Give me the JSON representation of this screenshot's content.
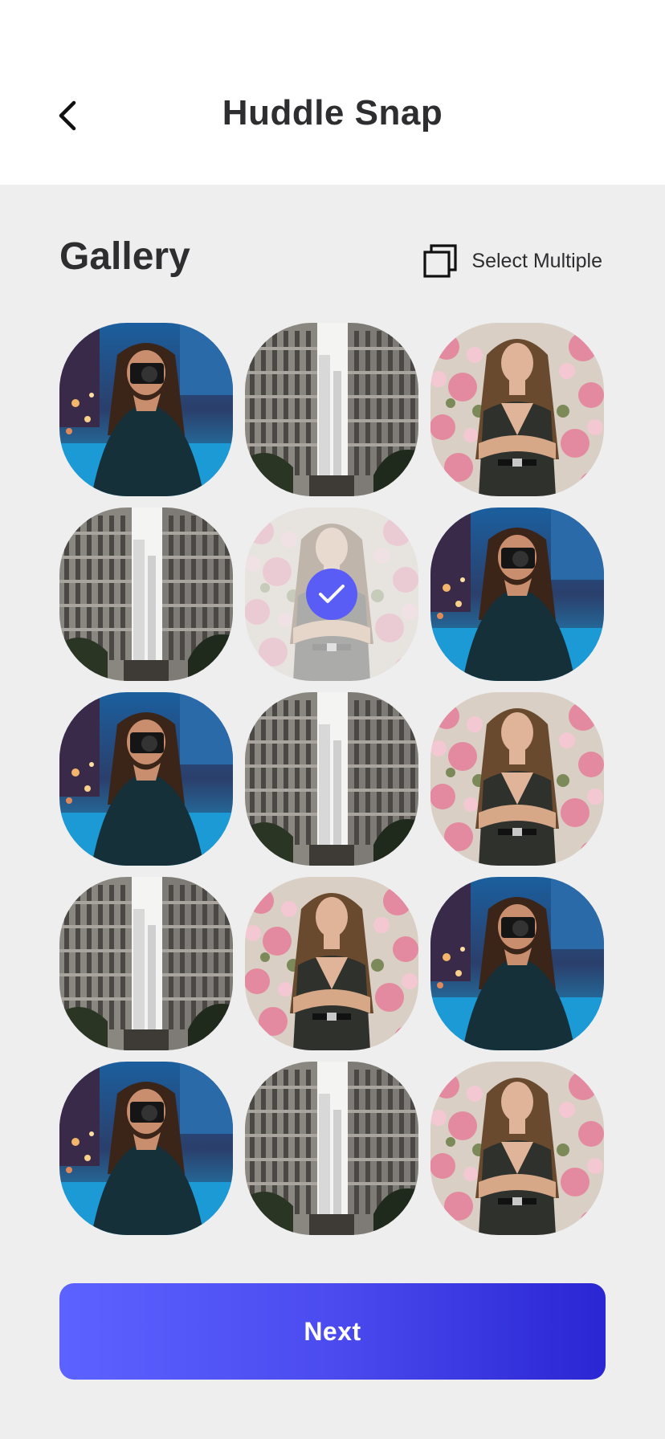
{
  "header": {
    "title": "Huddle Snap",
    "back_icon": "chevron-left-icon"
  },
  "gallery": {
    "title": "Gallery",
    "select_multiple_label": "Select Multiple",
    "select_multiple_icon": "copy-stack-icon",
    "photos": [
      {
        "kind": "photographer",
        "selected": false
      },
      {
        "kind": "city",
        "selected": false
      },
      {
        "kind": "flowers",
        "selected": false
      },
      {
        "kind": "city",
        "selected": false
      },
      {
        "kind": "flowers",
        "selected": true
      },
      {
        "kind": "photographer",
        "selected": false
      },
      {
        "kind": "photographer",
        "selected": false
      },
      {
        "kind": "city",
        "selected": false
      },
      {
        "kind": "flowers",
        "selected": false
      },
      {
        "kind": "city",
        "selected": false
      },
      {
        "kind": "flowers",
        "selected": false
      },
      {
        "kind": "photographer",
        "selected": false
      },
      {
        "kind": "photographer",
        "selected": false
      },
      {
        "kind": "city",
        "selected": false
      },
      {
        "kind": "flowers",
        "selected": false
      }
    ]
  },
  "footer": {
    "next_label": "Next"
  },
  "colors": {
    "accent": "#5A5CF6",
    "accent_dark": "#2A26D3",
    "background": "#EEEEEF",
    "text": "#2E2E30"
  }
}
